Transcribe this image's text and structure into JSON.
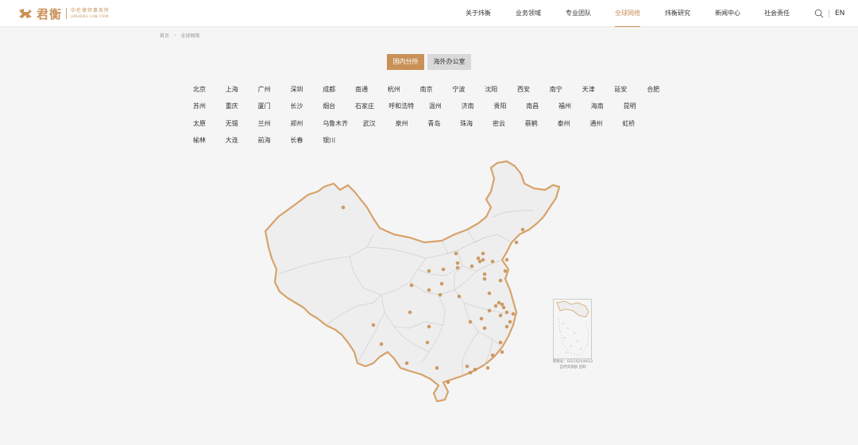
{
  "header": {
    "logo": {
      "cn": "君衡",
      "sub_cn": "中伦律师事务所",
      "sub_en": "JUNHENG LAW FIRM"
    },
    "nav": [
      {
        "label": "关于炜衡",
        "active": false
      },
      {
        "label": "业务领域",
        "active": false
      },
      {
        "label": "专业团队",
        "active": false
      },
      {
        "label": "全球网络",
        "active": true
      },
      {
        "label": "炜衡研究",
        "active": false
      },
      {
        "label": "新闻中心",
        "active": false
      },
      {
        "label": "社会责任",
        "active": false
      }
    ],
    "lang": "EN",
    "search_icon": "search-icon"
  },
  "breadcrumb": {
    "home": "首页",
    "separator": "›",
    "current": "全球网络"
  },
  "tabs": {
    "domestic": "国内分所",
    "overseas": "海外办公室"
  },
  "cities": [
    [
      "北京",
      "上海",
      "广州",
      "深圳",
      "成都",
      "南通",
      "杭州",
      "南京",
      "宁波",
      "沈阳",
      "西安",
      "南宁",
      "天津",
      "延安",
      "合肥"
    ],
    [
      "苏州",
      "重庆",
      "厦门",
      "长沙",
      "烟台",
      "石家庄",
      "呼和浩特",
      "温州",
      "济南",
      "贵阳",
      "南昌",
      "福州",
      "海南",
      "昆明"
    ],
    [
      "太原",
      "无锡",
      "兰州",
      "郑州",
      "乌鲁木齐",
      "武汉",
      "泉州",
      "青岛",
      "珠海",
      "密云",
      "蔡鹤",
      "泰州",
      "通州",
      "虹桥"
    ],
    [
      "榆林",
      "大连",
      "前海",
      "长春",
      "银川"
    ]
  ],
  "map": {
    "inset_caption_1": "审图号：GS(2024)4632",
    "inset_caption_2": "自然资源部 监制"
  },
  "colors": {
    "accent": "#c99158",
    "page_bg": "#f5f5f5",
    "header_bg": "#ffffff",
    "tab_inactive_bg": "#d9d9d9",
    "map_fill": "#eeeeee",
    "map_border": "#d7a26a",
    "province_line": "#cfcfcf"
  }
}
